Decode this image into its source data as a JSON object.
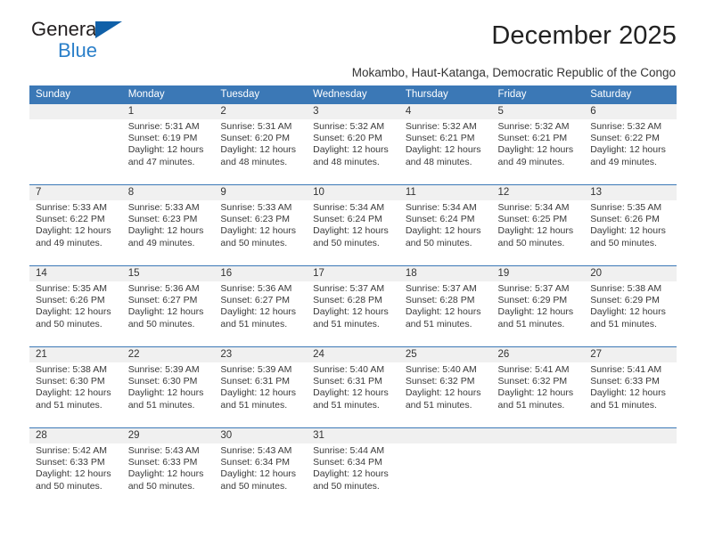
{
  "brand": {
    "name_top": "General",
    "name_bottom": "Blue",
    "accent_color": "#2a7fc9",
    "triangle_color": "#1060a8"
  },
  "header": {
    "month_title": "December 2025",
    "location": "Mokambo, Haut-Katanga, Democratic Republic of the Congo"
  },
  "calendar": {
    "header_bg": "#3b78b6",
    "daynum_bg": "#f0f0f0",
    "weekdays": [
      "Sunday",
      "Monday",
      "Tuesday",
      "Wednesday",
      "Thursday",
      "Friday",
      "Saturday"
    ],
    "weeks": [
      [
        {
          "day": "",
          "lines": []
        },
        {
          "day": "1",
          "lines": [
            "Sunrise: 5:31 AM",
            "Sunset: 6:19 PM",
            "Daylight: 12 hours",
            "and 47 minutes."
          ]
        },
        {
          "day": "2",
          "lines": [
            "Sunrise: 5:31 AM",
            "Sunset: 6:20 PM",
            "Daylight: 12 hours",
            "and 48 minutes."
          ]
        },
        {
          "day": "3",
          "lines": [
            "Sunrise: 5:32 AM",
            "Sunset: 6:20 PM",
            "Daylight: 12 hours",
            "and 48 minutes."
          ]
        },
        {
          "day": "4",
          "lines": [
            "Sunrise: 5:32 AM",
            "Sunset: 6:21 PM",
            "Daylight: 12 hours",
            "and 48 minutes."
          ]
        },
        {
          "day": "5",
          "lines": [
            "Sunrise: 5:32 AM",
            "Sunset: 6:21 PM",
            "Daylight: 12 hours",
            "and 49 minutes."
          ]
        },
        {
          "day": "6",
          "lines": [
            "Sunrise: 5:32 AM",
            "Sunset: 6:22 PM",
            "Daylight: 12 hours",
            "and 49 minutes."
          ]
        }
      ],
      [
        {
          "day": "7",
          "lines": [
            "Sunrise: 5:33 AM",
            "Sunset: 6:22 PM",
            "Daylight: 12 hours",
            "and 49 minutes."
          ]
        },
        {
          "day": "8",
          "lines": [
            "Sunrise: 5:33 AM",
            "Sunset: 6:23 PM",
            "Daylight: 12 hours",
            "and 49 minutes."
          ]
        },
        {
          "day": "9",
          "lines": [
            "Sunrise: 5:33 AM",
            "Sunset: 6:23 PM",
            "Daylight: 12 hours",
            "and 50 minutes."
          ]
        },
        {
          "day": "10",
          "lines": [
            "Sunrise: 5:34 AM",
            "Sunset: 6:24 PM",
            "Daylight: 12 hours",
            "and 50 minutes."
          ]
        },
        {
          "day": "11",
          "lines": [
            "Sunrise: 5:34 AM",
            "Sunset: 6:24 PM",
            "Daylight: 12 hours",
            "and 50 minutes."
          ]
        },
        {
          "day": "12",
          "lines": [
            "Sunrise: 5:34 AM",
            "Sunset: 6:25 PM",
            "Daylight: 12 hours",
            "and 50 minutes."
          ]
        },
        {
          "day": "13",
          "lines": [
            "Sunrise: 5:35 AM",
            "Sunset: 6:26 PM",
            "Daylight: 12 hours",
            "and 50 minutes."
          ]
        }
      ],
      [
        {
          "day": "14",
          "lines": [
            "Sunrise: 5:35 AM",
            "Sunset: 6:26 PM",
            "Daylight: 12 hours",
            "and 50 minutes."
          ]
        },
        {
          "day": "15",
          "lines": [
            "Sunrise: 5:36 AM",
            "Sunset: 6:27 PM",
            "Daylight: 12 hours",
            "and 50 minutes."
          ]
        },
        {
          "day": "16",
          "lines": [
            "Sunrise: 5:36 AM",
            "Sunset: 6:27 PM",
            "Daylight: 12 hours",
            "and 51 minutes."
          ]
        },
        {
          "day": "17",
          "lines": [
            "Sunrise: 5:37 AM",
            "Sunset: 6:28 PM",
            "Daylight: 12 hours",
            "and 51 minutes."
          ]
        },
        {
          "day": "18",
          "lines": [
            "Sunrise: 5:37 AM",
            "Sunset: 6:28 PM",
            "Daylight: 12 hours",
            "and 51 minutes."
          ]
        },
        {
          "day": "19",
          "lines": [
            "Sunrise: 5:37 AM",
            "Sunset: 6:29 PM",
            "Daylight: 12 hours",
            "and 51 minutes."
          ]
        },
        {
          "day": "20",
          "lines": [
            "Sunrise: 5:38 AM",
            "Sunset: 6:29 PM",
            "Daylight: 12 hours",
            "and 51 minutes."
          ]
        }
      ],
      [
        {
          "day": "21",
          "lines": [
            "Sunrise: 5:38 AM",
            "Sunset: 6:30 PM",
            "Daylight: 12 hours",
            "and 51 minutes."
          ]
        },
        {
          "day": "22",
          "lines": [
            "Sunrise: 5:39 AM",
            "Sunset: 6:30 PM",
            "Daylight: 12 hours",
            "and 51 minutes."
          ]
        },
        {
          "day": "23",
          "lines": [
            "Sunrise: 5:39 AM",
            "Sunset: 6:31 PM",
            "Daylight: 12 hours",
            "and 51 minutes."
          ]
        },
        {
          "day": "24",
          "lines": [
            "Sunrise: 5:40 AM",
            "Sunset: 6:31 PM",
            "Daylight: 12 hours",
            "and 51 minutes."
          ]
        },
        {
          "day": "25",
          "lines": [
            "Sunrise: 5:40 AM",
            "Sunset: 6:32 PM",
            "Daylight: 12 hours",
            "and 51 minutes."
          ]
        },
        {
          "day": "26",
          "lines": [
            "Sunrise: 5:41 AM",
            "Sunset: 6:32 PM",
            "Daylight: 12 hours",
            "and 51 minutes."
          ]
        },
        {
          "day": "27",
          "lines": [
            "Sunrise: 5:41 AM",
            "Sunset: 6:33 PM",
            "Daylight: 12 hours",
            "and 51 minutes."
          ]
        }
      ],
      [
        {
          "day": "28",
          "lines": [
            "Sunrise: 5:42 AM",
            "Sunset: 6:33 PM",
            "Daylight: 12 hours",
            "and 50 minutes."
          ]
        },
        {
          "day": "29",
          "lines": [
            "Sunrise: 5:43 AM",
            "Sunset: 6:33 PM",
            "Daylight: 12 hours",
            "and 50 minutes."
          ]
        },
        {
          "day": "30",
          "lines": [
            "Sunrise: 5:43 AM",
            "Sunset: 6:34 PM",
            "Daylight: 12 hours",
            "and 50 minutes."
          ]
        },
        {
          "day": "31",
          "lines": [
            "Sunrise: 5:44 AM",
            "Sunset: 6:34 PM",
            "Daylight: 12 hours",
            "and 50 minutes."
          ]
        },
        {
          "day": "",
          "lines": []
        },
        {
          "day": "",
          "lines": []
        },
        {
          "day": "",
          "lines": []
        }
      ]
    ]
  }
}
